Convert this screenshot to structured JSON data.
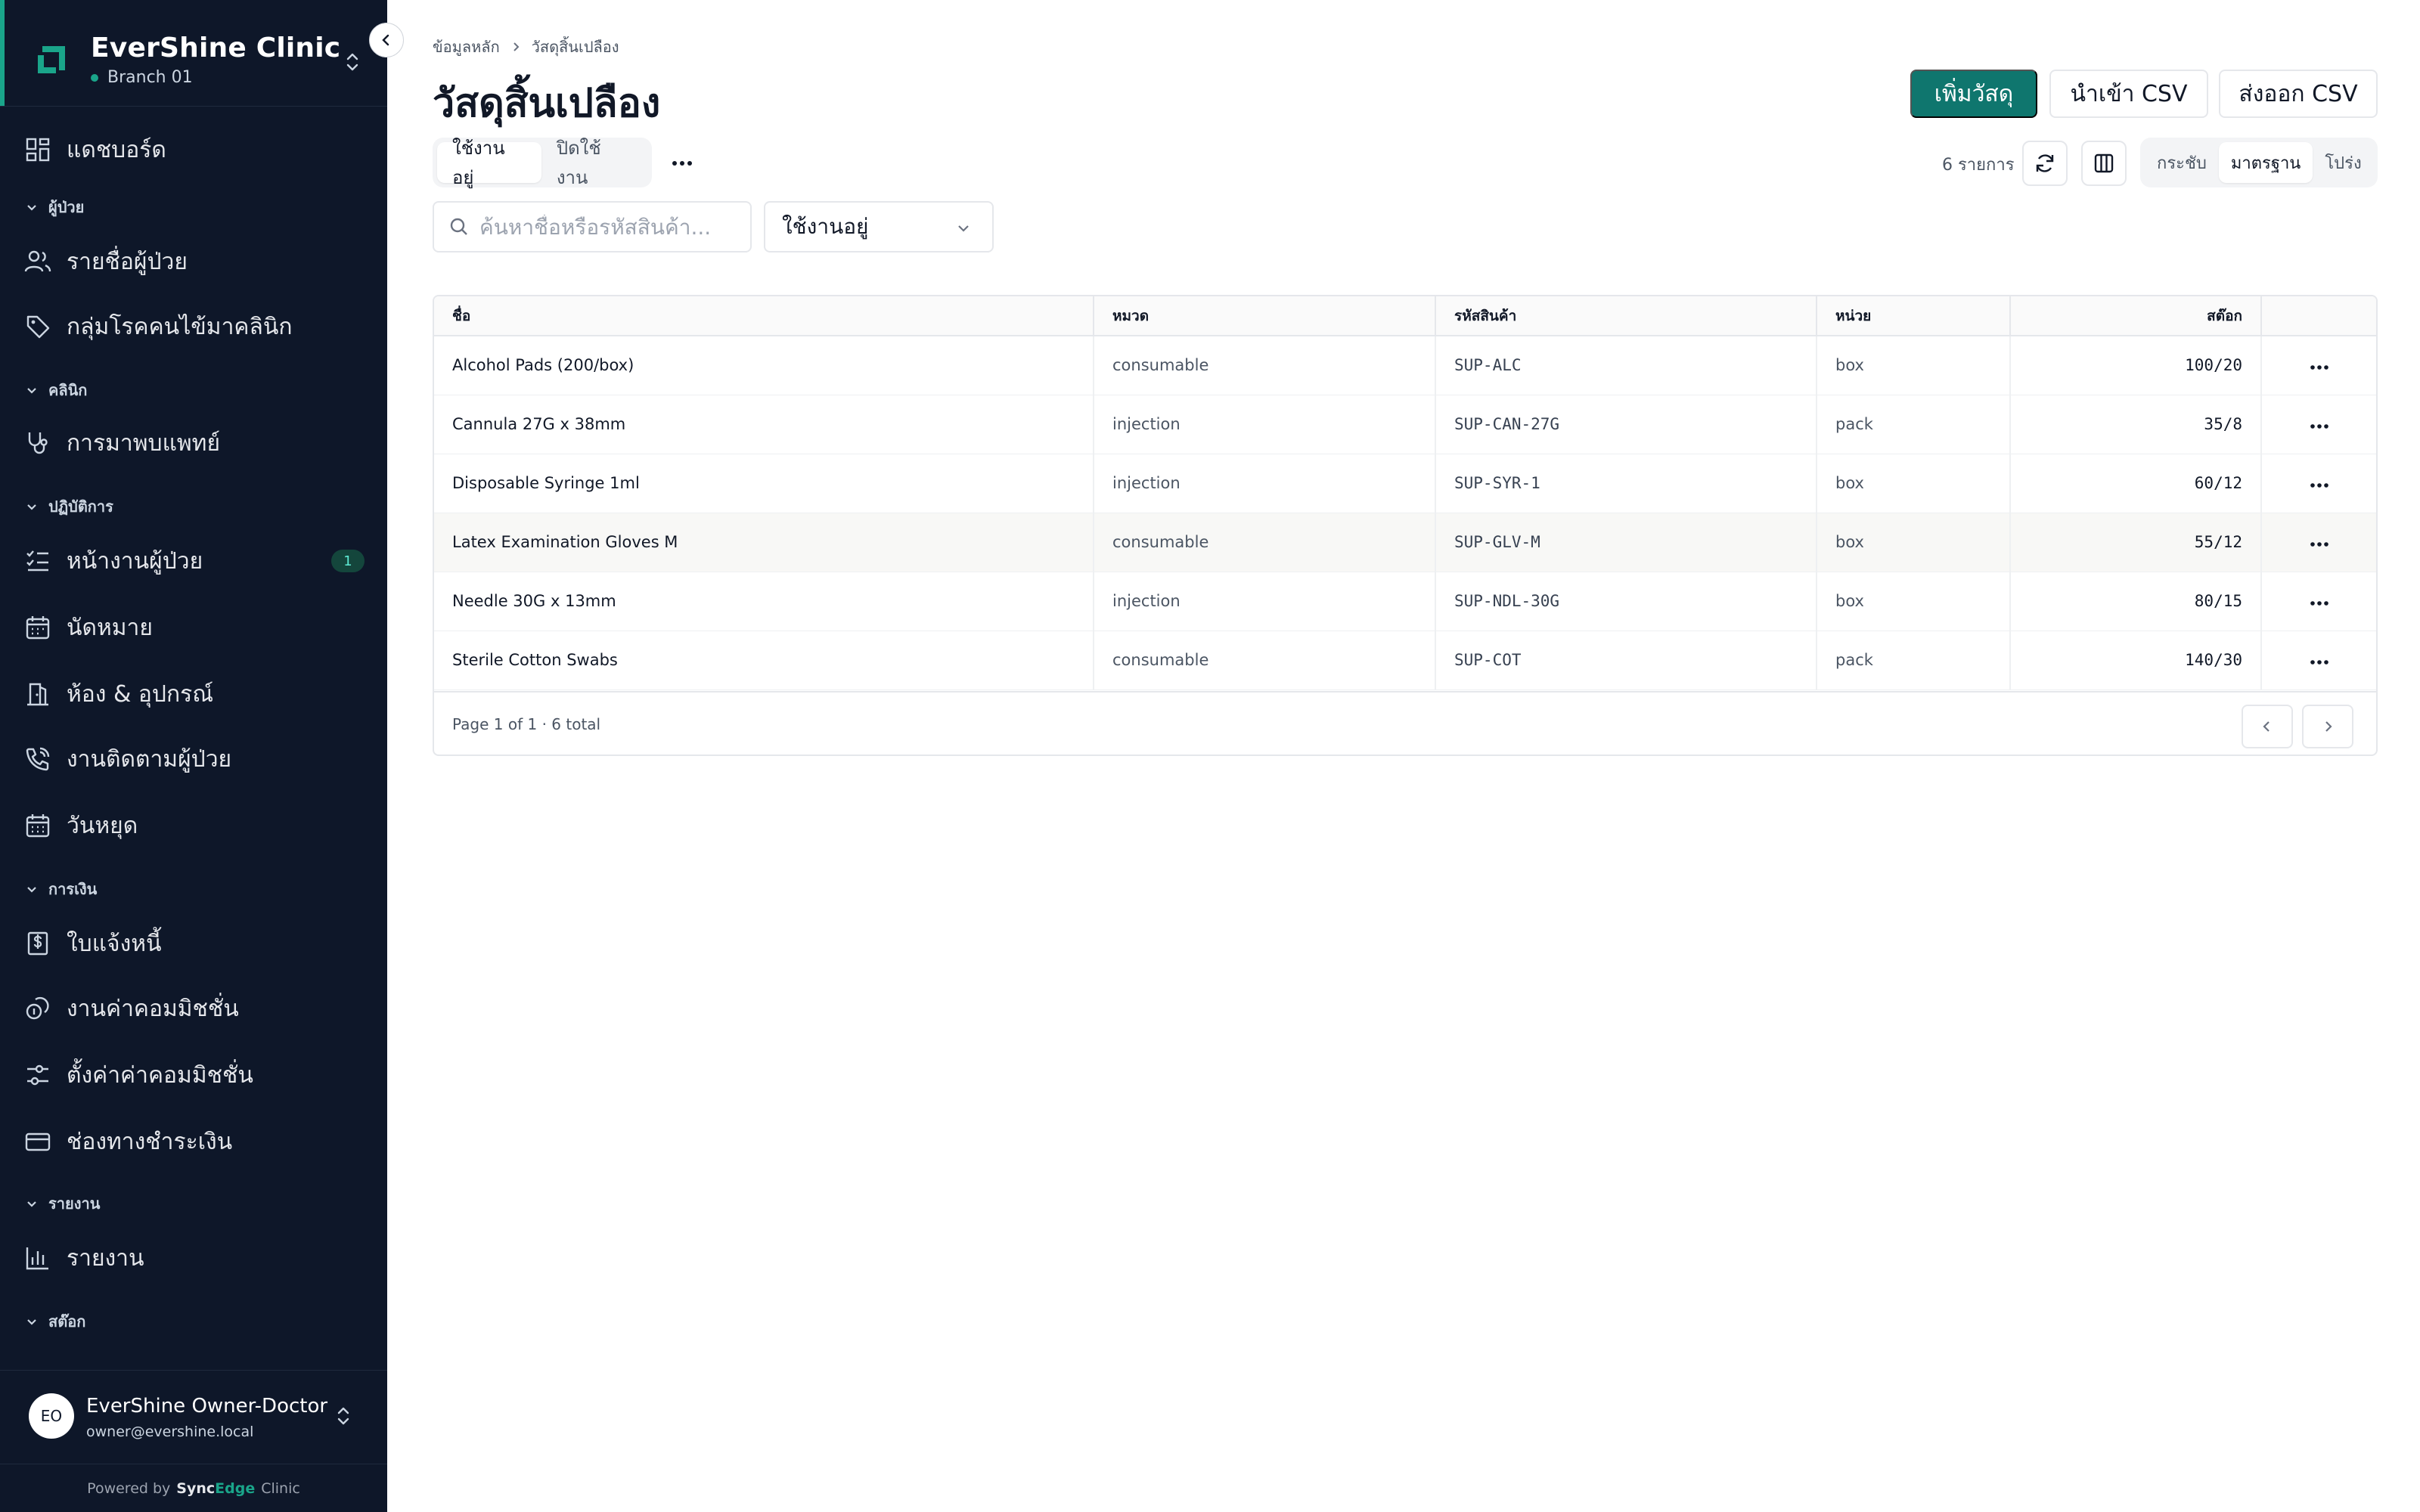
{
  "brand": {
    "name": "EverShine Clinic",
    "branch": "Branch 01"
  },
  "nav": {
    "dashboard": "แดชบอร์ด",
    "sec_patients": "ผู้ป่วย",
    "patient_list": "รายชื่อผู้ป่วย",
    "patient_groups": "กลุ่มโรคคนไข้มาคลินิก",
    "sec_clinic": "คลินิก",
    "visits": "การมาพบแพทย์",
    "sec_operations": "ปฏิบัติการ",
    "patient_tasks": "หน้างานผู้ป่วย",
    "patient_tasks_badge": "1",
    "appointments": "นัดหมาย",
    "rooms": "ห้อง & อุปกรณ์",
    "followups": "งานติดตามผู้ป่วย",
    "holidays": "วันหยุด",
    "sec_finance": "การเงิน",
    "invoices": "ใบแจ้งหนี้",
    "commissions": "งานค่าคอมมิชชั่น",
    "commission_settings": "ตั้งค่าค่าคอมมิชชั่น",
    "payment_channels": "ช่องทางชำระเงิน",
    "sec_reports": "รายงาน",
    "reports": "รายงาน",
    "sec_stock": "สต๊อก"
  },
  "user": {
    "initials": "EO",
    "name": "EverShine Owner-Doctor",
    "email": "owner@evershine.local"
  },
  "powered": {
    "prefix": "Powered by",
    "sync": "Sync",
    "edge": "Edge",
    "suffix": "Clinic"
  },
  "breadcrumb": {
    "root": "ข้อมูลหลัก",
    "current": "วัสดุสิ้นเปลือง"
  },
  "page": {
    "title": "วัสดุสิ้นเปลือง"
  },
  "actions": {
    "add": "เพิ่มวัสดุ",
    "import": "นำเข้า CSV",
    "export": "ส่งออก CSV"
  },
  "tabs": {
    "active": "ใช้งานอยู่",
    "inactive": "ปิดใช้งาน"
  },
  "toolbar": {
    "count": "6 รายการ",
    "density_compact": "กระชับ",
    "density_standard": "มาตรฐาน",
    "density_loose": "โปร่ง"
  },
  "filters": {
    "search_placeholder": "ค้นหาชื่อหรือรหัสสินค้า...",
    "status": "ใช้งานอยู่"
  },
  "table": {
    "headers": {
      "name": "ชื่อ",
      "category": "หมวด",
      "code": "รหัสสินค้า",
      "unit": "หน่วย",
      "stock": "สต๊อก"
    },
    "rows": [
      {
        "name": "Alcohol Pads (200/box)",
        "category": "consumable",
        "code": "SUP-ALC",
        "unit": "box",
        "stock": "100/20"
      },
      {
        "name": "Cannula 27G x 38mm",
        "category": "injection",
        "code": "SUP-CAN-27G",
        "unit": "pack",
        "stock": "35/8"
      },
      {
        "name": "Disposable Syringe 1ml",
        "category": "injection",
        "code": "SUP-SYR-1",
        "unit": "box",
        "stock": "60/12"
      },
      {
        "name": "Latex Examination Gloves M",
        "category": "consumable",
        "code": "SUP-GLV-M",
        "unit": "box",
        "stock": "55/12"
      },
      {
        "name": "Needle 30G x 13mm",
        "category": "injection",
        "code": "SUP-NDL-30G",
        "unit": "box",
        "stock": "80/15"
      },
      {
        "name": "Sterile Cotton Swabs",
        "category": "consumable",
        "code": "SUP-COT",
        "unit": "pack",
        "stock": "140/30"
      }
    ],
    "footer": "Page 1 of 1 · 6 total"
  },
  "colors": {
    "sidebar_bg": "#0e1729",
    "accent": "#1aa58a",
    "primary_button": "#0f766e"
  }
}
